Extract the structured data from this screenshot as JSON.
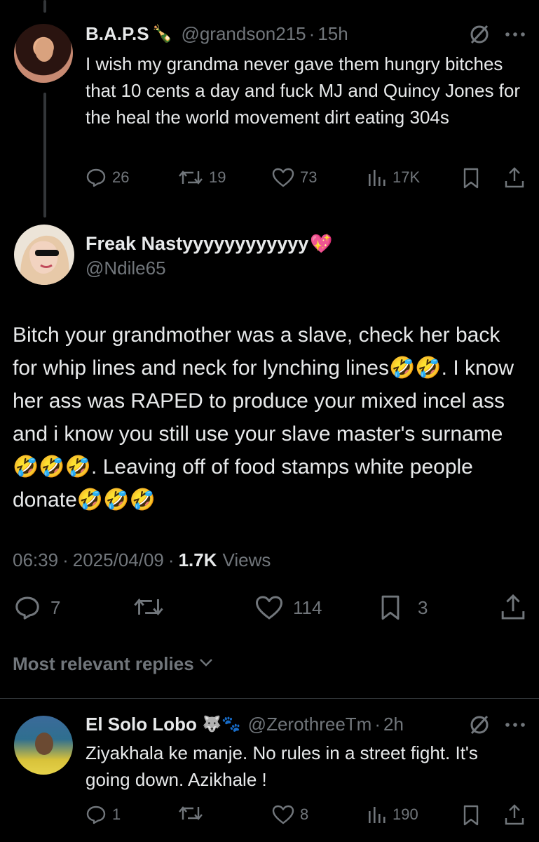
{
  "reply_top": {
    "display_name": "B.A.P.S",
    "name_emoji": "🍾",
    "handle": "@grandson215",
    "sep": "·",
    "time": "15h",
    "text": "I wish my grandma never gave them hungry bitches that 10 cents a day and fuck MJ and Quincy Jones for the heal the world movement dirt eating 304s",
    "reply_count": "26",
    "retweet_count": "19",
    "like_count": "73",
    "view_count": "17K"
  },
  "main_post": {
    "display_name": "Freak Nastyyyyyyyyyyyy",
    "name_emoji": "💖",
    "handle": "@Ndile65",
    "text": "Bitch your grandmother was a slave, check her back for whip lines and neck for lynching lines🤣🤣. I know her ass was RAPED to produce your mixed incel ass and i know you still use your slave master's surname🤣🤣🤣. Leaving off of food stamps white people donate🤣🤣🤣",
    "time": "06:39",
    "date": "2025/04/09",
    "views_count": "1.7K",
    "views_label": "Views",
    "reply_count": "7",
    "like_count": "114",
    "bookmark_count": "3"
  },
  "sort": {
    "label": "Most relevant replies"
  },
  "reply_bottom": {
    "display_name": "El Solo Lobo",
    "name_emoji": "🐺🐾",
    "handle": "@ZerothreeTm",
    "sep": "·",
    "time": "2h",
    "text": "Ziyakhala ke manje. No rules in a street fight. It's going down. Azikhale !",
    "reply_count": "1",
    "like_count": "8",
    "view_count": "190"
  },
  "icons": {
    "grok": "grok-slash-icon",
    "more": "more-dots-icon",
    "reply": "reply-bubble-icon",
    "retweet": "retweet-icon",
    "like": "heart-icon",
    "views": "views-bars-icon",
    "bookmark": "bookmark-icon",
    "share": "share-icon"
  },
  "colors": {
    "background": "#000000",
    "text": "#e7e9ea",
    "muted": "#71767b",
    "divider": "#2f3336"
  }
}
